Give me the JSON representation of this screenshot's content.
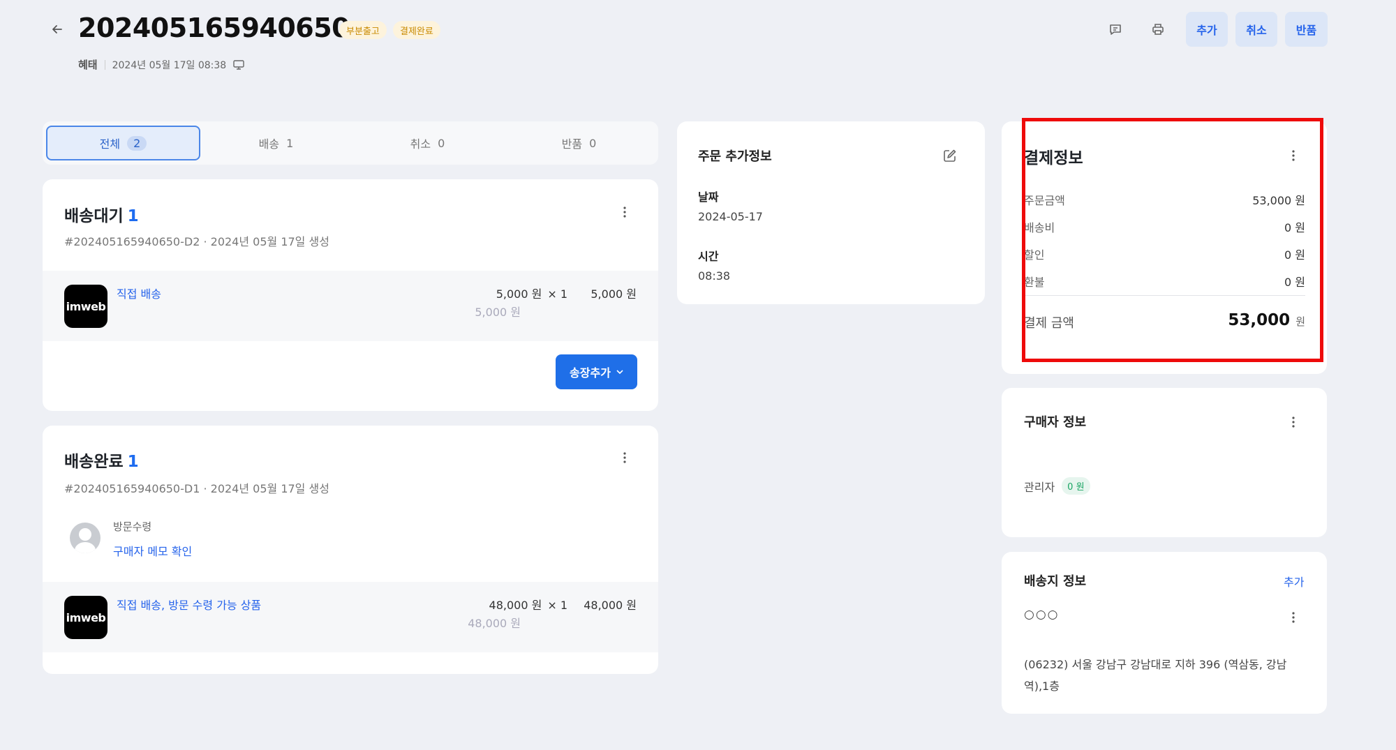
{
  "header": {
    "order_number": "202405165940650",
    "badges": [
      "부분출고",
      "결제완료"
    ],
    "customer_name": "혜태",
    "order_datetime": "2024년 05월 17일 08:38",
    "actions": {
      "add": "추가",
      "cancel": "취소",
      "return": "반품"
    }
  },
  "tabs": [
    {
      "label": "전체",
      "count": "2",
      "active": true
    },
    {
      "label": "배송",
      "count": "1",
      "active": false
    },
    {
      "label": "취소",
      "count": "0",
      "active": false
    },
    {
      "label": "반품",
      "count": "0",
      "active": false
    }
  ],
  "shipments": [
    {
      "status": "배송대기",
      "count": "1",
      "sub": "#202405165940650-D2 · 2024년 05월 17일 생성",
      "item": {
        "logo_text": "imweb",
        "name": "직접 배송",
        "unit_price": "5,000 원",
        "qty": "× 1",
        "orig_price": "5,000 원",
        "total": "5,000 원"
      },
      "invoice_button": "송장추가"
    },
    {
      "status": "배송완료",
      "count": "1",
      "sub": "#202405165940650-D1 · 2024년 05월 17일 생성",
      "pickup_label": "방문수령",
      "memo_link": "구매자 메모 확인",
      "item": {
        "logo_text": "imweb",
        "name": "직접 배송, 방문 수령 가능 상품",
        "unit_price": "48,000 원",
        "qty": "× 1",
        "orig_price": "48,000 원",
        "total": "48,000 원"
      }
    }
  ],
  "extra_info": {
    "title": "주문 추가정보",
    "date_label": "날짜",
    "date_value": "2024-05-17",
    "time_label": "시간",
    "time_value": "08:38"
  },
  "payment": {
    "title": "결제정보",
    "rows": [
      {
        "label": "주문금액",
        "value": "53,000 원"
      },
      {
        "label": "배송비",
        "value": "0 원"
      },
      {
        "label": "할인",
        "value": "0 원"
      },
      {
        "label": "환불",
        "value": "0 원"
      }
    ],
    "total_label": "결제 금액",
    "total_value": "53,000",
    "total_unit": "원"
  },
  "buyer": {
    "title": "구매자 정보",
    "name": "관리자",
    "points": "0 원"
  },
  "shipping_address": {
    "title": "배송지 정보",
    "add_link": "추가",
    "recipient": "○○○",
    "address_line1": "(06232) 서울 강남구 강남대로 지하 396 (역삼동, 강남",
    "address_line2": "역),1층"
  },
  "colors": {
    "accent": "#1f6fe8",
    "highlight": "#ee0a0a",
    "background": "#eef0f5"
  }
}
